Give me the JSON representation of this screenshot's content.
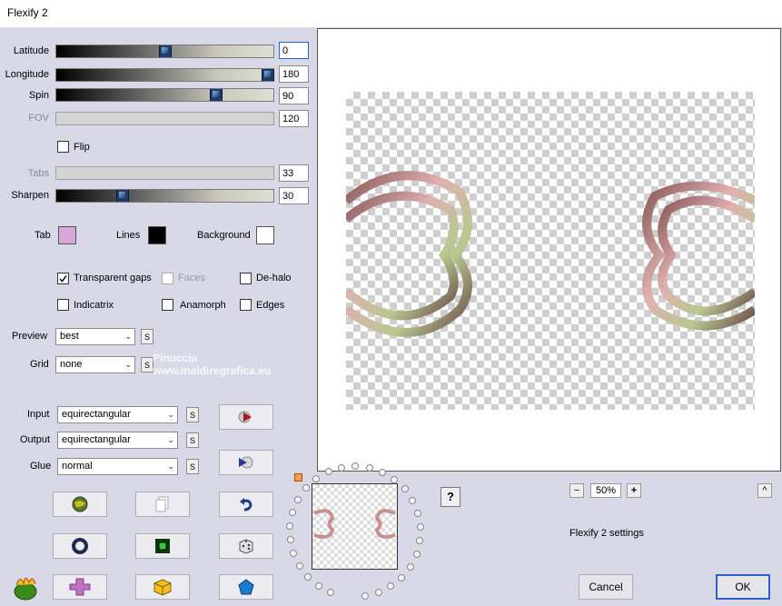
{
  "window": {
    "title": "Flexify 2"
  },
  "sliders": [
    {
      "label": "Latitude",
      "value": "0",
      "enabled": true
    },
    {
      "label": "Longitude",
      "value": "180",
      "enabled": true
    },
    {
      "label": "Spin",
      "value": "90",
      "enabled": true
    },
    {
      "label": "FOV",
      "value": "120",
      "enabled": false
    },
    {
      "label": "Tabs",
      "value": "33",
      "enabled": false
    },
    {
      "label": "Sharpen",
      "value": "30",
      "enabled": true
    }
  ],
  "flip": {
    "label": "Flip",
    "checked": false
  },
  "colors": {
    "tab": {
      "label": "Tab",
      "color": "#d9a8d9"
    },
    "lines": {
      "label": "Lines",
      "color": "#000000"
    },
    "background": {
      "label": "Background",
      "color": "#ffffff"
    }
  },
  "options": [
    {
      "label": "Transparent gaps",
      "checked": true,
      "enabled": true
    },
    {
      "label": "Faces",
      "checked": false,
      "enabled": false
    },
    {
      "label": "De-halo",
      "checked": false,
      "enabled": true
    },
    {
      "label": "Indicatrix",
      "checked": false,
      "enabled": true
    },
    {
      "label": "Anamorph",
      "checked": false,
      "enabled": true
    },
    {
      "label": "Edges",
      "checked": false,
      "enabled": true
    }
  ],
  "preview_mode": {
    "label": "Preview",
    "value": "best"
  },
  "grid": {
    "label": "Grid",
    "value": "none"
  },
  "input": {
    "label": "Input",
    "value": "equirectangular"
  },
  "output": {
    "label": "Output",
    "value": "equirectangular"
  },
  "glue": {
    "label": "Glue",
    "value": "normal"
  },
  "s_button_label": "S",
  "zoom": {
    "minus": "−",
    "value": "50%",
    "plus": "+"
  },
  "help_label": "?",
  "collapse_label": "^",
  "settings_label": "Flexify 2 settings",
  "watermark": "Pinuccia\nwww.maidiregrafica.eu",
  "cancel_label": "Cancel",
  "ok_label": "OK",
  "accent_color": "#2a62c8"
}
